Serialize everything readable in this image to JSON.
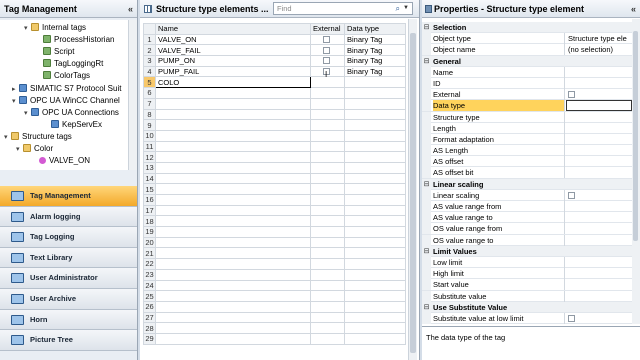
{
  "left_panel": {
    "title": "Tag Management",
    "collapse_glyph": "«",
    "tree": [
      {
        "label": "Internal tags",
        "icon": "folder"
      },
      {
        "label": "ProcessHistorian",
        "icon": "tag"
      },
      {
        "label": "Script",
        "icon": "tag"
      },
      {
        "label": "TagLoggingRt",
        "icon": "tag"
      },
      {
        "label": "ColorTags",
        "icon": "tag"
      },
      {
        "label": "SIMATIC S7 Protocol Suit",
        "icon": "conn"
      },
      {
        "label": "OPC UA WinCC Channel",
        "icon": "conn"
      },
      {
        "label": "OPC UA Connections",
        "icon": "conn"
      },
      {
        "label": "KepServEx",
        "icon": "conn"
      },
      {
        "label": "Structure tags",
        "icon": "folder"
      },
      {
        "label": "Color",
        "icon": "folder"
      },
      {
        "label": "VALVE_ON",
        "icon": "color"
      }
    ],
    "splitter": "....",
    "nav": [
      {
        "label": "Tag Management",
        "active": true
      },
      {
        "label": "Alarm logging",
        "active": false
      },
      {
        "label": "Tag Logging",
        "active": false
      },
      {
        "label": "Text Library",
        "active": false
      },
      {
        "label": "User Administrator",
        "active": false
      },
      {
        "label": "User Archive",
        "active": false
      },
      {
        "label": "Horn",
        "active": false
      },
      {
        "label": "Picture Tree",
        "active": false
      }
    ]
  },
  "center_panel": {
    "title": "Structure type elements ...",
    "find_placeholder": "Find",
    "columns": [
      "Name",
      "External",
      "Data type"
    ],
    "rows": [
      {
        "num": "1",
        "name": "VALVE_ON",
        "type": "Binary Tag"
      },
      {
        "num": "2",
        "name": "VALVE_FAIL",
        "type": "Binary Tag"
      },
      {
        "num": "3",
        "name": "PUMP_ON",
        "type": "Binary Tag"
      },
      {
        "num": "4",
        "name": "PUMP_FAIL",
        "type": "Binary Tag"
      },
      {
        "num": "5",
        "name": "COLO",
        "type": ""
      }
    ],
    "empty_row_numbers": [
      "6",
      "7",
      "8",
      "9",
      "10",
      "11",
      "12",
      "13",
      "14",
      "15",
      "16",
      "17",
      "18",
      "19",
      "20",
      "21",
      "22",
      "23",
      "24",
      "25",
      "26",
      "27",
      "28",
      "29"
    ]
  },
  "right_panel": {
    "title": "Properties - Structure type element",
    "collapse_glyph": "«",
    "rows": [
      {
        "kind": "cat",
        "name": "Selection"
      },
      {
        "kind": "prop",
        "name": "Object type",
        "value": "Structure type ele"
      },
      {
        "kind": "prop",
        "name": "Object name",
        "value": "(no selection)"
      },
      {
        "kind": "cat",
        "name": "General"
      },
      {
        "kind": "prop",
        "name": "Name",
        "value": ""
      },
      {
        "kind": "prop",
        "name": "ID",
        "value": ""
      },
      {
        "kind": "check",
        "name": "External",
        "value": ""
      },
      {
        "kind": "hl",
        "name": "Data type",
        "value": ""
      },
      {
        "kind": "prop",
        "name": "Structure type",
        "value": ""
      },
      {
        "kind": "prop",
        "name": "Length",
        "value": ""
      },
      {
        "kind": "prop",
        "name": "Format adaptation",
        "value": ""
      },
      {
        "kind": "prop",
        "name": "AS Length",
        "value": ""
      },
      {
        "kind": "prop",
        "name": "AS offset",
        "value": ""
      },
      {
        "kind": "prop",
        "name": "AS offset bit",
        "value": ""
      },
      {
        "kind": "cat",
        "name": "Linear scaling"
      },
      {
        "kind": "check",
        "name": "Linear scaling",
        "value": ""
      },
      {
        "kind": "prop",
        "name": "AS value range from",
        "value": ""
      },
      {
        "kind": "prop",
        "name": "AS value range to",
        "value": ""
      },
      {
        "kind": "prop",
        "name": "OS value range from",
        "value": ""
      },
      {
        "kind": "prop",
        "name": "OS value range to",
        "value": ""
      },
      {
        "kind": "cat",
        "name": "Limit Values"
      },
      {
        "kind": "prop",
        "name": "Low limit",
        "value": ""
      },
      {
        "kind": "prop",
        "name": "High limit",
        "value": ""
      },
      {
        "kind": "prop",
        "name": "Start value",
        "value": ""
      },
      {
        "kind": "prop",
        "name": "Substitute value",
        "value": ""
      },
      {
        "kind": "cat",
        "name": "Use Substitute Value"
      },
      {
        "kind": "check",
        "name": "Substitute value at low limit",
        "value": ""
      }
    ],
    "description": "The data type of the tag"
  },
  "colors": {
    "accent_active": "#f3a92a",
    "highlight": "#ffd35c",
    "panel_bg": "#e9eef4"
  }
}
